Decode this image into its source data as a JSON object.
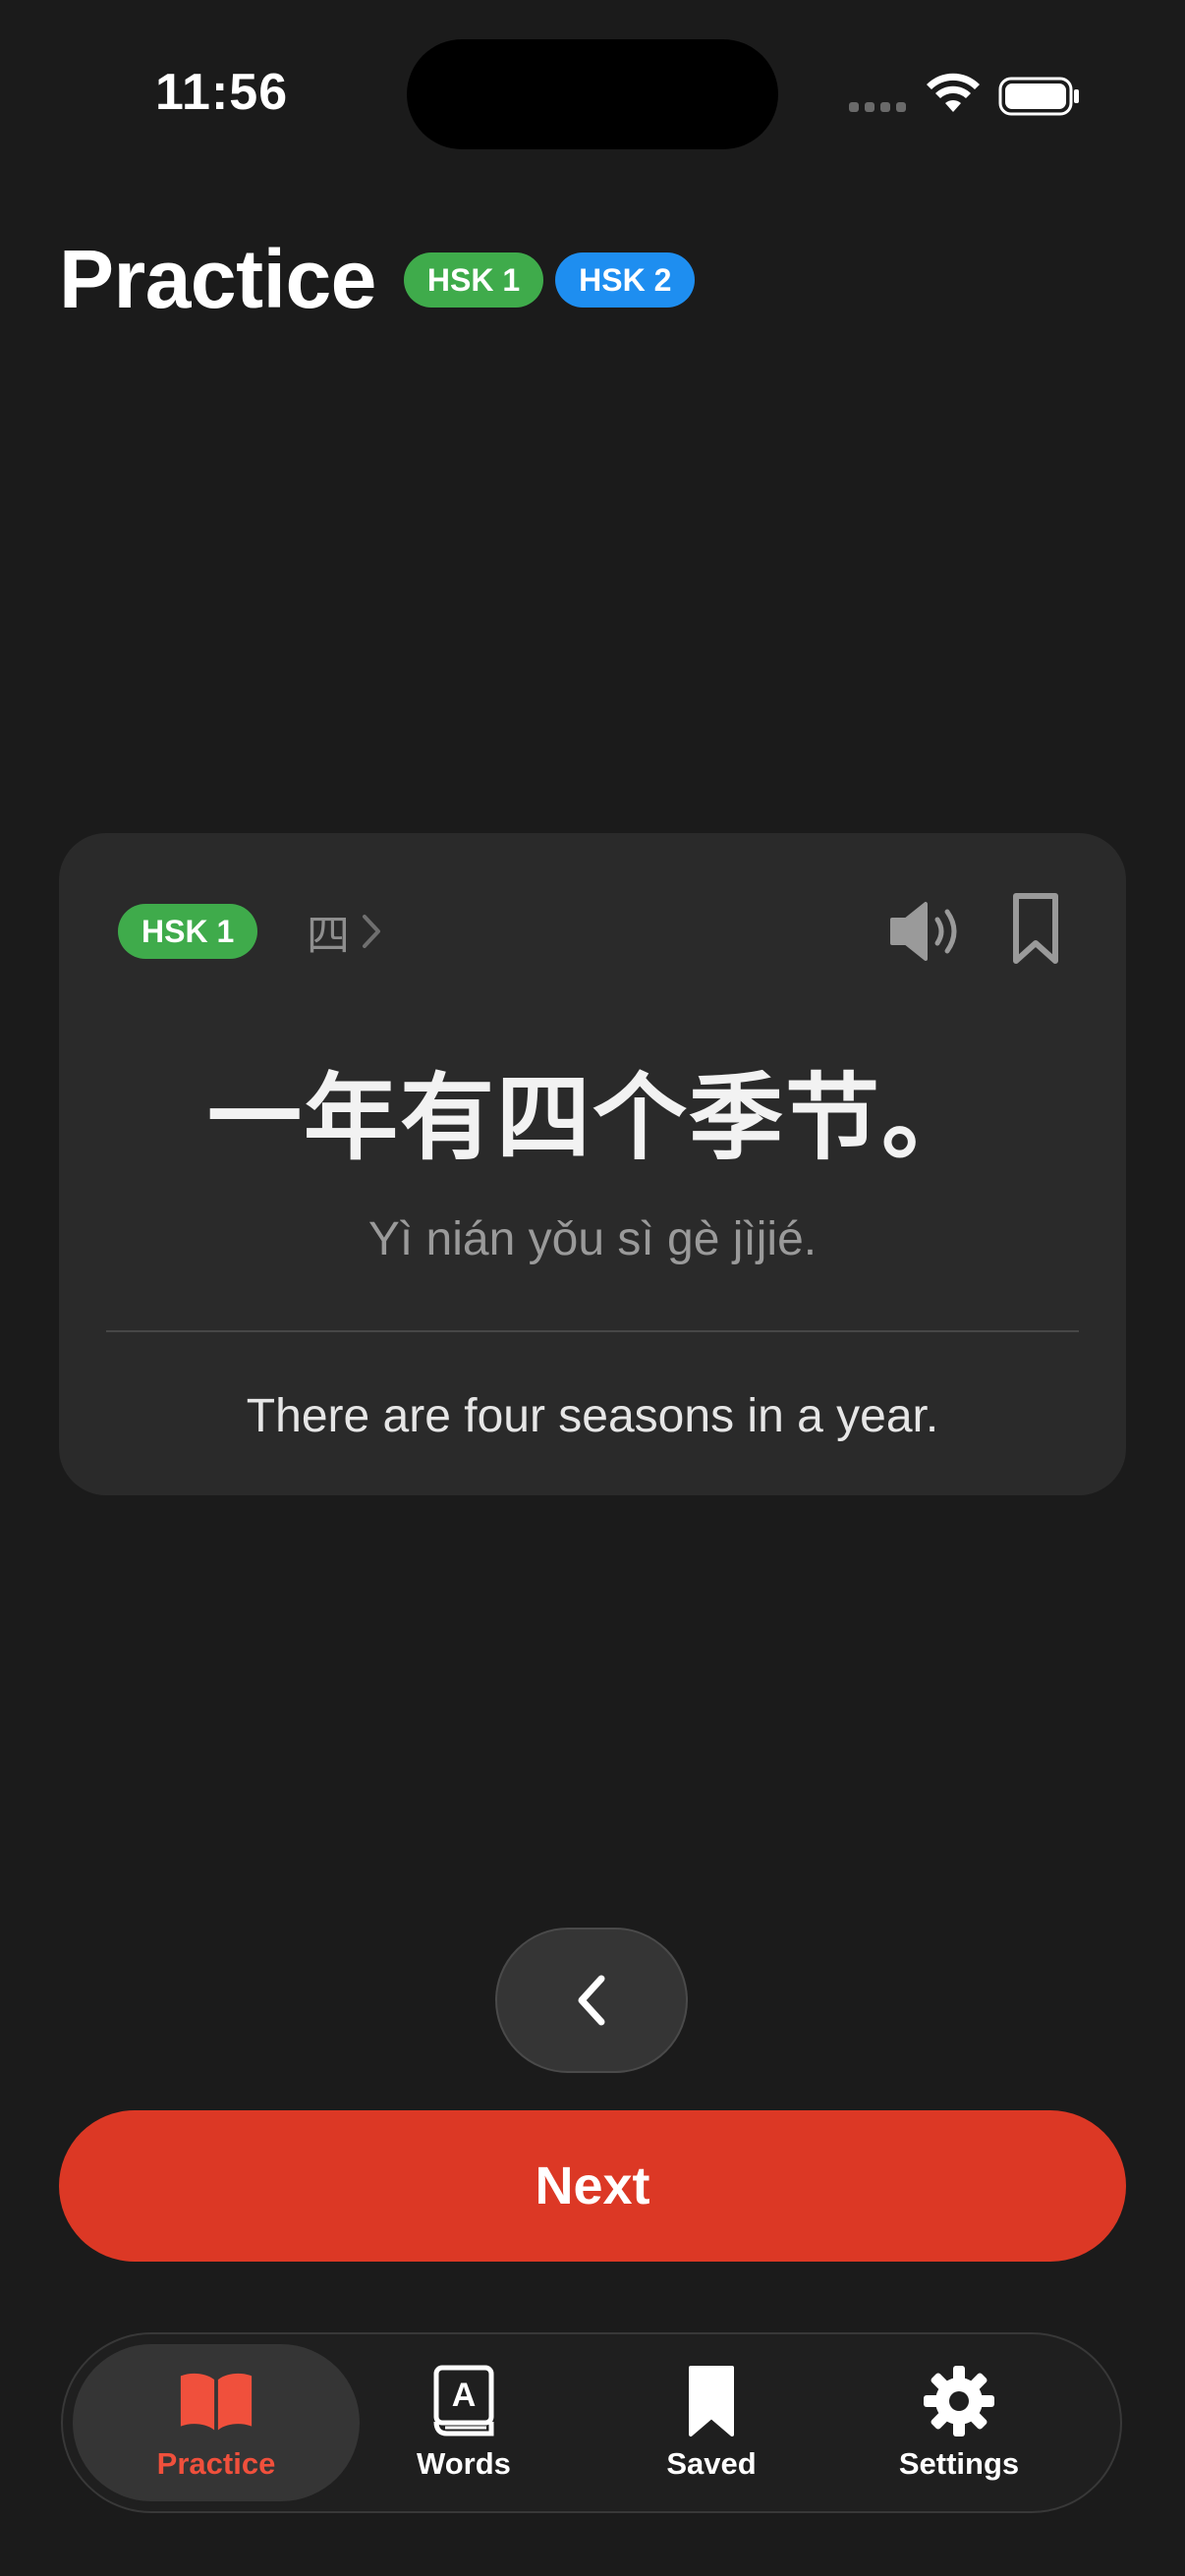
{
  "status_bar": {
    "time": "11:56"
  },
  "header": {
    "title": "Practice",
    "levels": [
      "HSK 1",
      "HSK 2"
    ]
  },
  "card": {
    "level": "HSK 1",
    "word": "四",
    "sentence": "一年有四个季节。",
    "pinyin": "Yì nián yǒu sì gè jìjié.",
    "translation": "There are four seasons in a year."
  },
  "actions": {
    "next_label": "Next"
  },
  "tabs": [
    {
      "label": "Practice",
      "icon": "open-book-icon",
      "active": true
    },
    {
      "label": "Words",
      "icon": "dictionary-icon",
      "active": false
    },
    {
      "label": "Saved",
      "icon": "bookmark-icon",
      "active": false
    },
    {
      "label": "Settings",
      "icon": "gear-icon",
      "active": false
    }
  ],
  "colors": {
    "background": "#1b1b1b",
    "card": "#2a2a2a",
    "accent": "#dc3825",
    "active_tab_label": "#f0503c",
    "hsk1": "#3fab4b",
    "hsk2": "#1e8ef0"
  }
}
